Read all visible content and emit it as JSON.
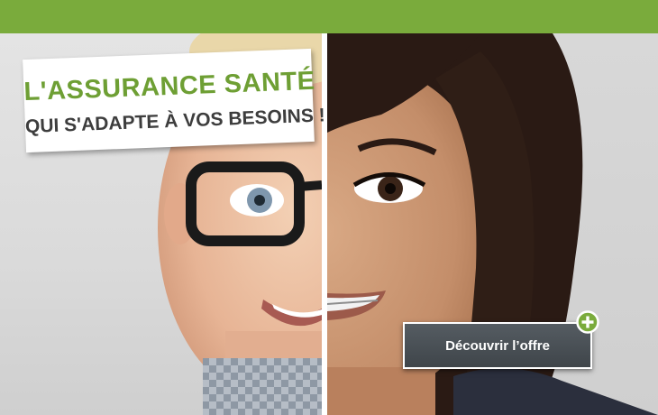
{
  "headline": {
    "line1": "L'ASSURANCE SANTÉ",
    "line2": "QUI S'ADAPTE À VOS BESOINS !"
  },
  "cta": {
    "label": "Découvrir l’offre",
    "icon": "plus-icon"
  },
  "colors": {
    "brand_green": "#7aab3c",
    "headline_green": "#6e9f34",
    "headline_dark": "#3d3d3d",
    "button_dark": "#464c51"
  },
  "images": {
    "left": "boy-with-glasses-photo",
    "right": "girl-with-braces-photo"
  }
}
